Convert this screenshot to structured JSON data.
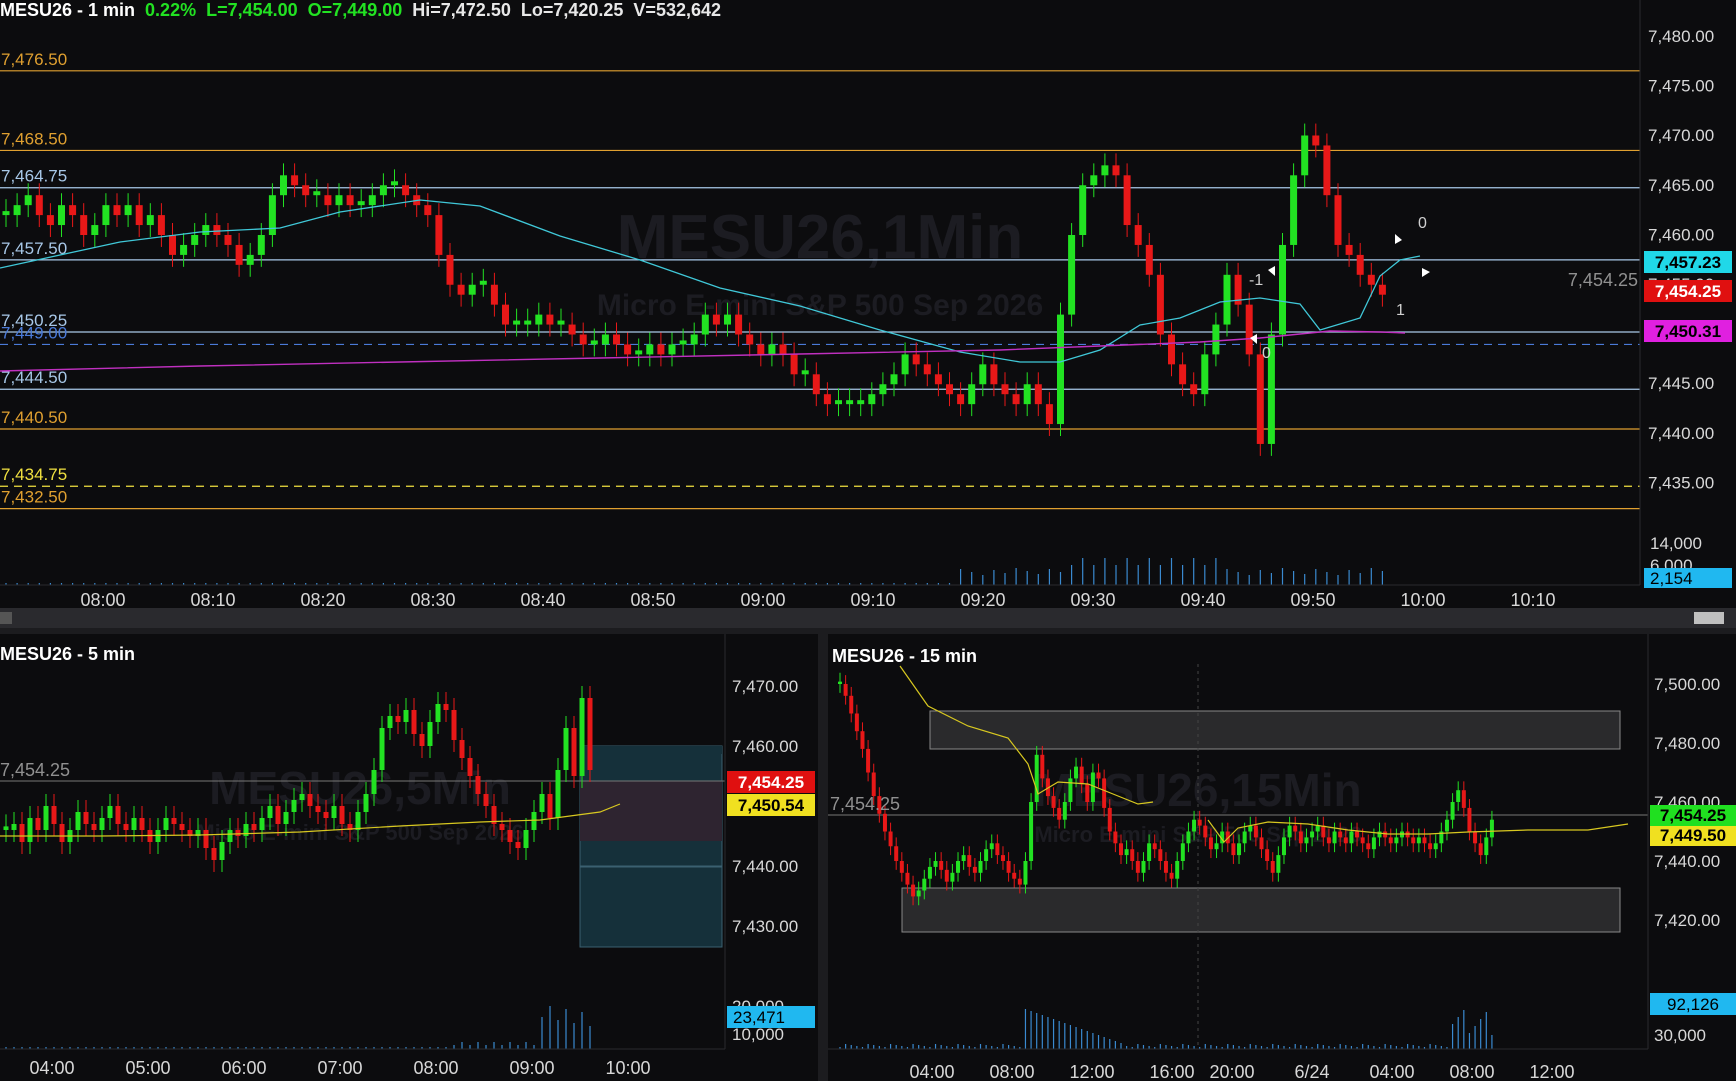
{
  "top": {
    "symbol": "MESU26 - 1 min",
    "change": "0.22%",
    "last": "L=7,454.00",
    "open": "O=7,449.00",
    "high": "Hi=7,472.50",
    "low": "Lo=7,420.25",
    "volume": "V=532,642",
    "watermark": "MESU26,1Min",
    "watermark_sub": "Micro E-mini S&P 500 Sep 2026",
    "y_ticks": [
      "7,480.00",
      "7,475.00",
      "7,470.00",
      "7,465.00",
      "7,460.00",
      "7,455.00",
      "7,450.00",
      "7,445.00",
      "7,440.00",
      "7,435.00"
    ],
    "x_ticks": [
      "08:00",
      "08:10",
      "08:20",
      "08:30",
      "08:40",
      "08:50",
      "09:00",
      "09:10",
      "09:20",
      "09:30",
      "09:40",
      "09:50",
      "10:00",
      "10:10"
    ],
    "levels": [
      {
        "label": "7,476.50",
        "value": 7476.5,
        "color": "#e0a030"
      },
      {
        "label": "7,468.50",
        "value": 7468.5,
        "color": "#e0a030"
      },
      {
        "label": "7,464.75",
        "value": 7464.75,
        "color": "#a8c8e8"
      },
      {
        "label": "7,457.50",
        "value": 7457.5,
        "color": "#a8c8e8"
      },
      {
        "label": "7,450.25",
        "value": 7450.25,
        "color": "#a8c8e8"
      },
      {
        "label": "7,449.00",
        "value": 7449.0,
        "color": "#4a7ad8"
      },
      {
        "label": "7,444.50",
        "value": 7444.5,
        "color": "#a8c8e8"
      },
      {
        "label": "7,440.50",
        "value": 7440.5,
        "color": "#e0a030"
      },
      {
        "label": "7,434.75",
        "value": 7434.75,
        "color": "#f0e040"
      },
      {
        "label": "7,432.50",
        "value": 7432.5,
        "color": "#e0a030"
      }
    ],
    "price_line_label": "7,454.25",
    "badges": [
      {
        "text": "7,457.23",
        "color": "#20d8e8"
      },
      {
        "text": "7,454.25",
        "color": "#e01010"
      },
      {
        "text": "7,450.31",
        "color": "#e020e0"
      }
    ],
    "vol_ticks": [
      "14,000",
      "6,000"
    ],
    "vol_badge": "2,154",
    "marks": [
      "0",
      "-1",
      "0",
      "1"
    ]
  },
  "left": {
    "symbol": "MESU26 - 5 min",
    "watermark": "MESU26,5Min",
    "watermark_sub": "Micro E-mini S&P 500 Sep 2026",
    "y_ticks": [
      "7,470.00",
      "7,460.00",
      "7,440.00",
      "7,430.00"
    ],
    "x_ticks": [
      "04:00",
      "05:00",
      "06:00",
      "07:00",
      "08:00",
      "09:00",
      "10:00"
    ],
    "price_line_label": "7,454.25",
    "badges": [
      {
        "text": "7,454.25",
        "color": "#e01010"
      },
      {
        "text": "7,450.54",
        "color": "#f0e020"
      }
    ],
    "vol_ticks": [
      "20,000",
      "10,000"
    ],
    "vol_badge": "23,471"
  },
  "right": {
    "symbol": "MESU26 - 15 min",
    "watermark": "MESU26,15Min",
    "watermark_sub": "Micro E-mini S&P 500 Sep 2026",
    "y_ticks": [
      "7,500.00",
      "7,480.00",
      "7,460.00",
      "7,440.00",
      "7,420.00"
    ],
    "x_ticks": [
      "04:00",
      "08:00",
      "12:00",
      "16:00",
      "20:00",
      "6/24",
      "04:00",
      "08:00",
      "12:00"
    ],
    "price_line_label": "7,454.25",
    "badges": [
      {
        "text": "7,454.25",
        "color": "#20e020"
      },
      {
        "text": "7,449.50",
        "color": "#f0e020"
      }
    ],
    "vol_ticks": [
      "30,000"
    ],
    "vol_badge": "92,126"
  },
  "colors": {
    "up": "#22e222",
    "down": "#e81818",
    "ema_top": "#40c8d8",
    "vwap": "#c030c0",
    "ema_low": "#d8c820"
  }
}
